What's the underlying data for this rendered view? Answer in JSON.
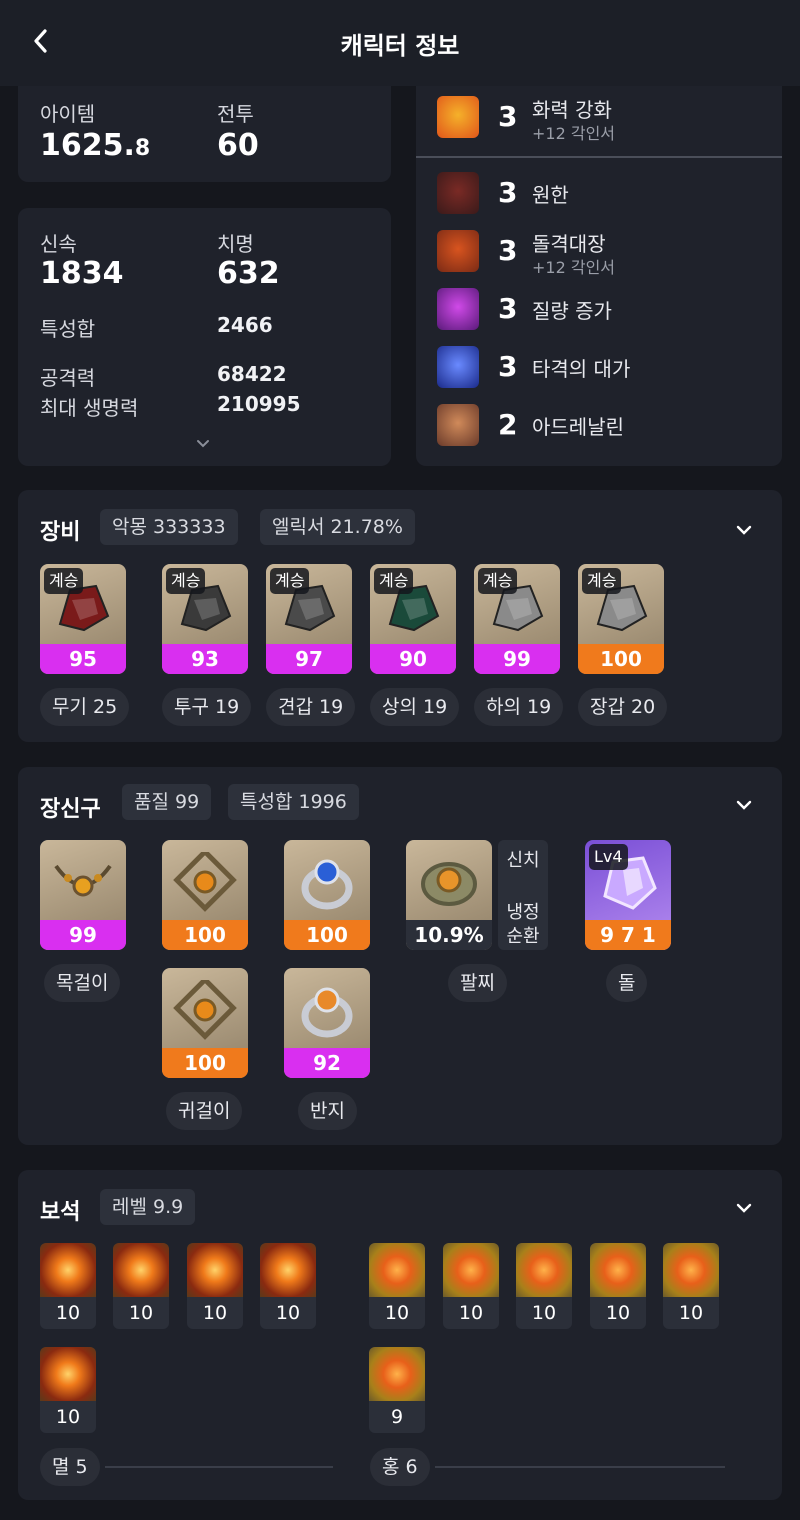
{
  "header": {
    "title": "캐릭터 정보"
  },
  "stats_top": {
    "item_label": "아이템",
    "item_level_main": "1625.",
    "item_level_dec": "8",
    "combat_label": "전투",
    "combat_value": "60"
  },
  "stats": {
    "swiftness_label": "신속",
    "swiftness_value": "1834",
    "crit_label": "치명",
    "crit_value": "632",
    "total_label": "특성합",
    "total_value": "2466",
    "attack_label": "공격력",
    "attack_value": "68422",
    "hp_label": "최대 생명력",
    "hp_value": "210995"
  },
  "engravings": [
    {
      "level": "3",
      "name": "화력 강화",
      "sub": "+12 각인서",
      "icon": "fire-icon"
    },
    {
      "level": "3",
      "name": "원한",
      "sub": "",
      "icon": "demon-icon"
    },
    {
      "level": "3",
      "name": "돌격대장",
      "sub": "+12 각인서",
      "icon": "charge-icon"
    },
    {
      "level": "3",
      "name": "질량 증가",
      "sub": "",
      "icon": "fist-icon"
    },
    {
      "level": "3",
      "name": "타격의 대가",
      "sub": "",
      "icon": "lightning-icon"
    },
    {
      "level": "2",
      "name": "아드레날린",
      "sub": "",
      "icon": "adrenaline-icon"
    }
  ],
  "equipment": {
    "title": "장비",
    "badges": [
      "악몽 333333",
      "엘릭서 21.78%"
    ],
    "items": [
      {
        "tag": "계승",
        "quality": "95",
        "name": "무기 25",
        "color": "#d92ff0"
      },
      {
        "tag": "계승",
        "quality": "93",
        "name": "투구 19",
        "color": "#d92ff0"
      },
      {
        "tag": "계승",
        "quality": "97",
        "name": "견갑 19",
        "color": "#d92ff0"
      },
      {
        "tag": "계승",
        "quality": "90",
        "name": "상의 19",
        "color": "#d92ff0"
      },
      {
        "tag": "계승",
        "quality": "99",
        "name": "하의 19",
        "color": "#d92ff0"
      },
      {
        "tag": "계승",
        "quality": "100",
        "name": "장갑 20",
        "color": "#f07a1c"
      }
    ]
  },
  "accessories": {
    "title": "장신구",
    "badges": [
      "품질 99",
      "특성합 1996"
    ],
    "necklace": {
      "quality": "99",
      "name": "목걸이"
    },
    "earrings": [
      {
        "quality": "100"
      },
      {
        "quality": "100"
      }
    ],
    "earring_name": "귀걸이",
    "rings": [
      {
        "quality": "100"
      },
      {
        "quality": "92"
      }
    ],
    "ring_name": "반지",
    "bracelet": {
      "value": "10.9%",
      "opts": [
        "신치",
        "냉정",
        "순환"
      ],
      "name": "팔찌"
    },
    "stone": {
      "level": "Lv4",
      "value": "9 7 1",
      "name": "돌"
    }
  },
  "gems": {
    "title": "보석",
    "badge": "레벨 9.9",
    "myul": {
      "levels": [
        "10",
        "10",
        "10",
        "10",
        "10"
      ],
      "label": "멸 5"
    },
    "hong": {
      "levels": [
        "10",
        "10",
        "10",
        "10",
        "10",
        "9"
      ],
      "label": "홍 6"
    }
  }
}
